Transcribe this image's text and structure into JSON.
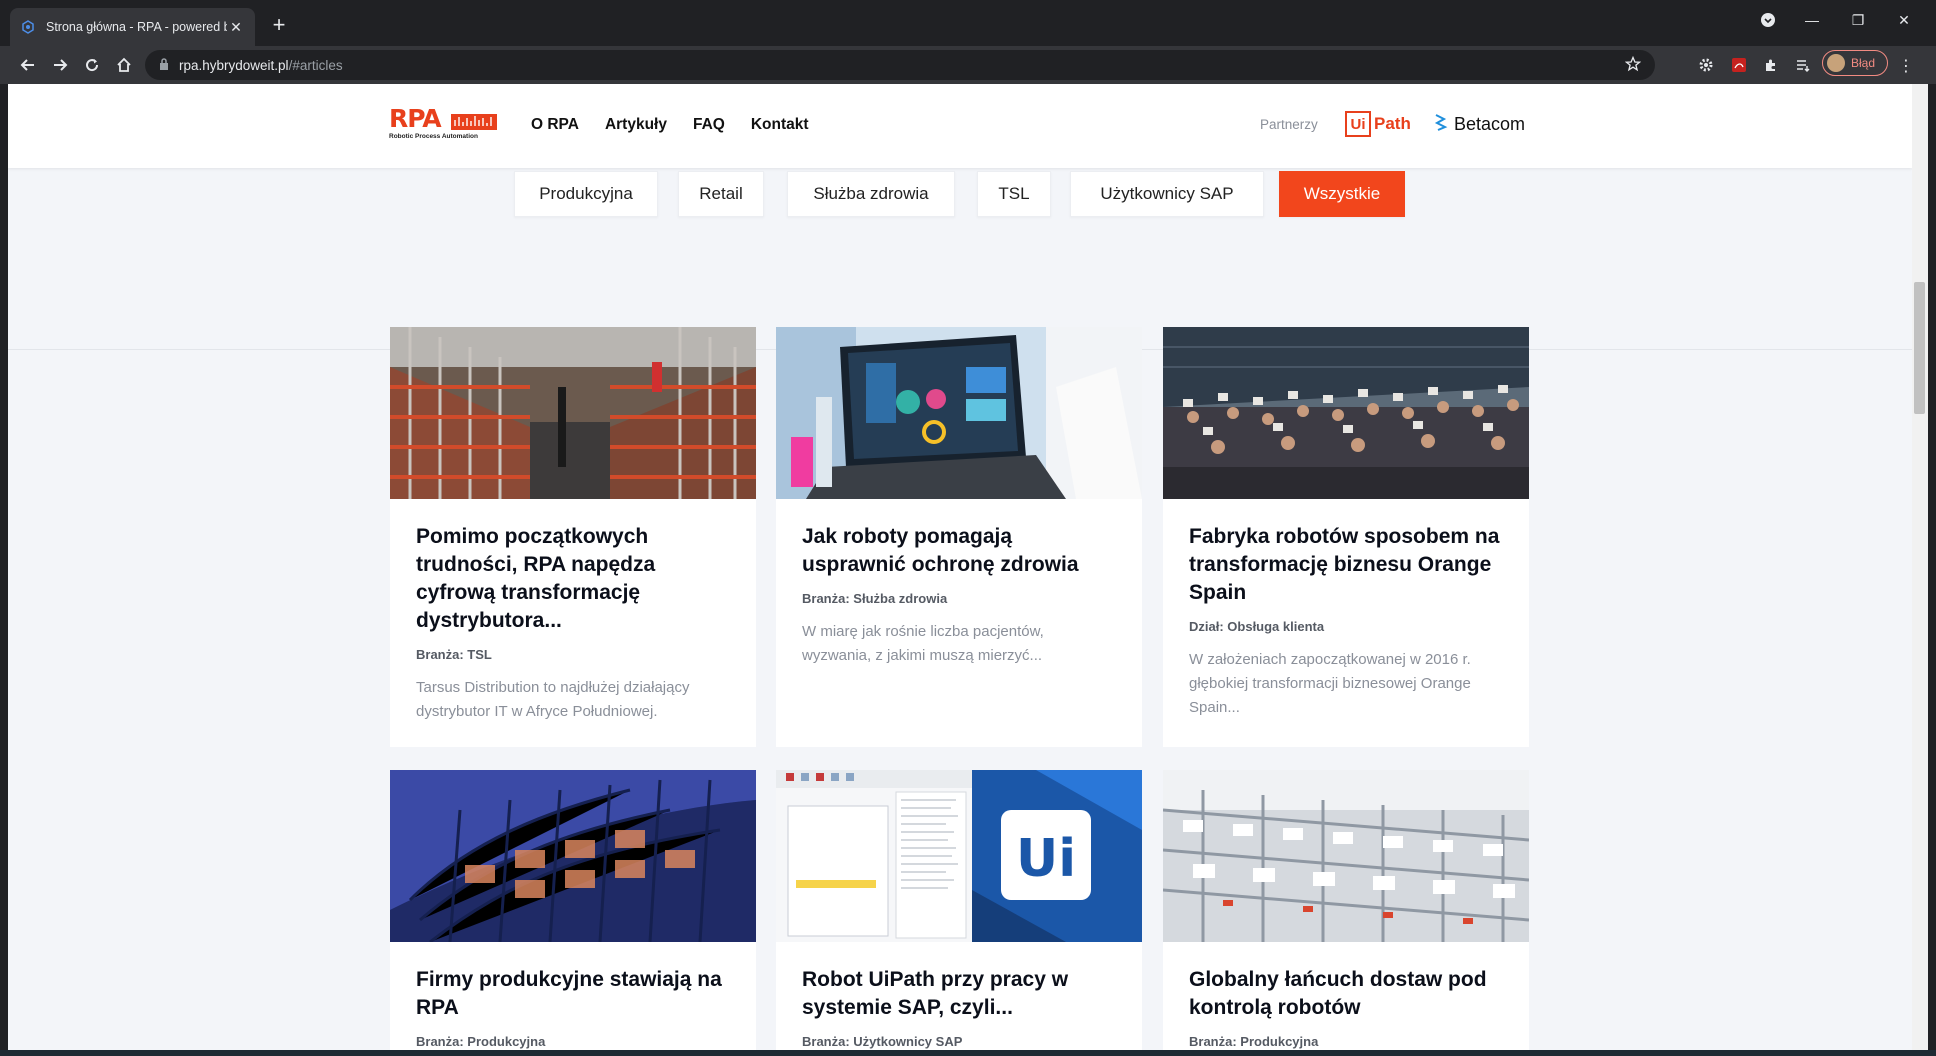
{
  "browser": {
    "tab_title": "Strona główna - RPA - powered b",
    "url_host": "rpa.hybrydoweit.pl",
    "url_path": "/#articles",
    "profile_label": "Błąd"
  },
  "header": {
    "logo_text": "RPA",
    "logo_sub": "Robotic Process Automation",
    "nav": [
      "O RPA",
      "Artykuły",
      "FAQ",
      "Kontakt"
    ],
    "partners_label": "Partnerzy",
    "partner_uipath": "Path",
    "partner_uipath_ui": "Ui",
    "partner_betacom": "Betacom"
  },
  "filters": [
    "Produkcyjna",
    "Retail",
    "Służba zdrowia",
    "TSL",
    "Użytkownicy SAP",
    "Wszystkie"
  ],
  "active_filter": "Wszystkie",
  "cards": [
    {
      "title": "Pomimo początkowych trudności, RPA napędza cyfrową transformację dystrybutora...",
      "meta": "Branża: TSL",
      "excerpt": "Tarsus Distribution to najdłużej działający dystrybutor IT w Afryce Południowej.",
      "image": "warehouse"
    },
    {
      "title": "Jak roboty pomagają usprawnić ochronę zdrowia",
      "meta": "Branża: Służba zdrowia",
      "excerpt": "W miarę jak rośnie liczba pacjentów, wyzwania, z jakimi muszą mierzyć...",
      "image": "laptop-lab"
    },
    {
      "title": "Fabryka robotów sposobem na transformację biznesu Orange Spain",
      "meta": "Dział: Obsługa klienta",
      "excerpt": "W założeniach zapoczątkowanej w 2016 r. głębokiej transformacji biznesowej Orange Spain...",
      "image": "group-photo"
    },
    {
      "title": "Firmy produkcyjne stawiają na RPA",
      "meta": "Branża: Produkcyjna",
      "excerpt": "",
      "image": "glass-building"
    },
    {
      "title": "Robot UiPath przy pracy w systemie SAP, czyli...",
      "meta": "Branża: Użytkownicy SAP",
      "excerpt": "",
      "image": "uipath-screenshot"
    },
    {
      "title": "Globalny łańcuch dostaw pod kontrolą robotów",
      "meta": "Branża: Produkcyjna",
      "excerpt": "",
      "image": "production-line"
    }
  ],
  "icons": [
    "tab-favicon",
    "tab-close-icon",
    "new-tab-icon",
    "back-icon",
    "forward-icon",
    "reload-icon",
    "home-icon",
    "lock-icon",
    "star-icon",
    "extension-icon",
    "menu-icon"
  ]
}
